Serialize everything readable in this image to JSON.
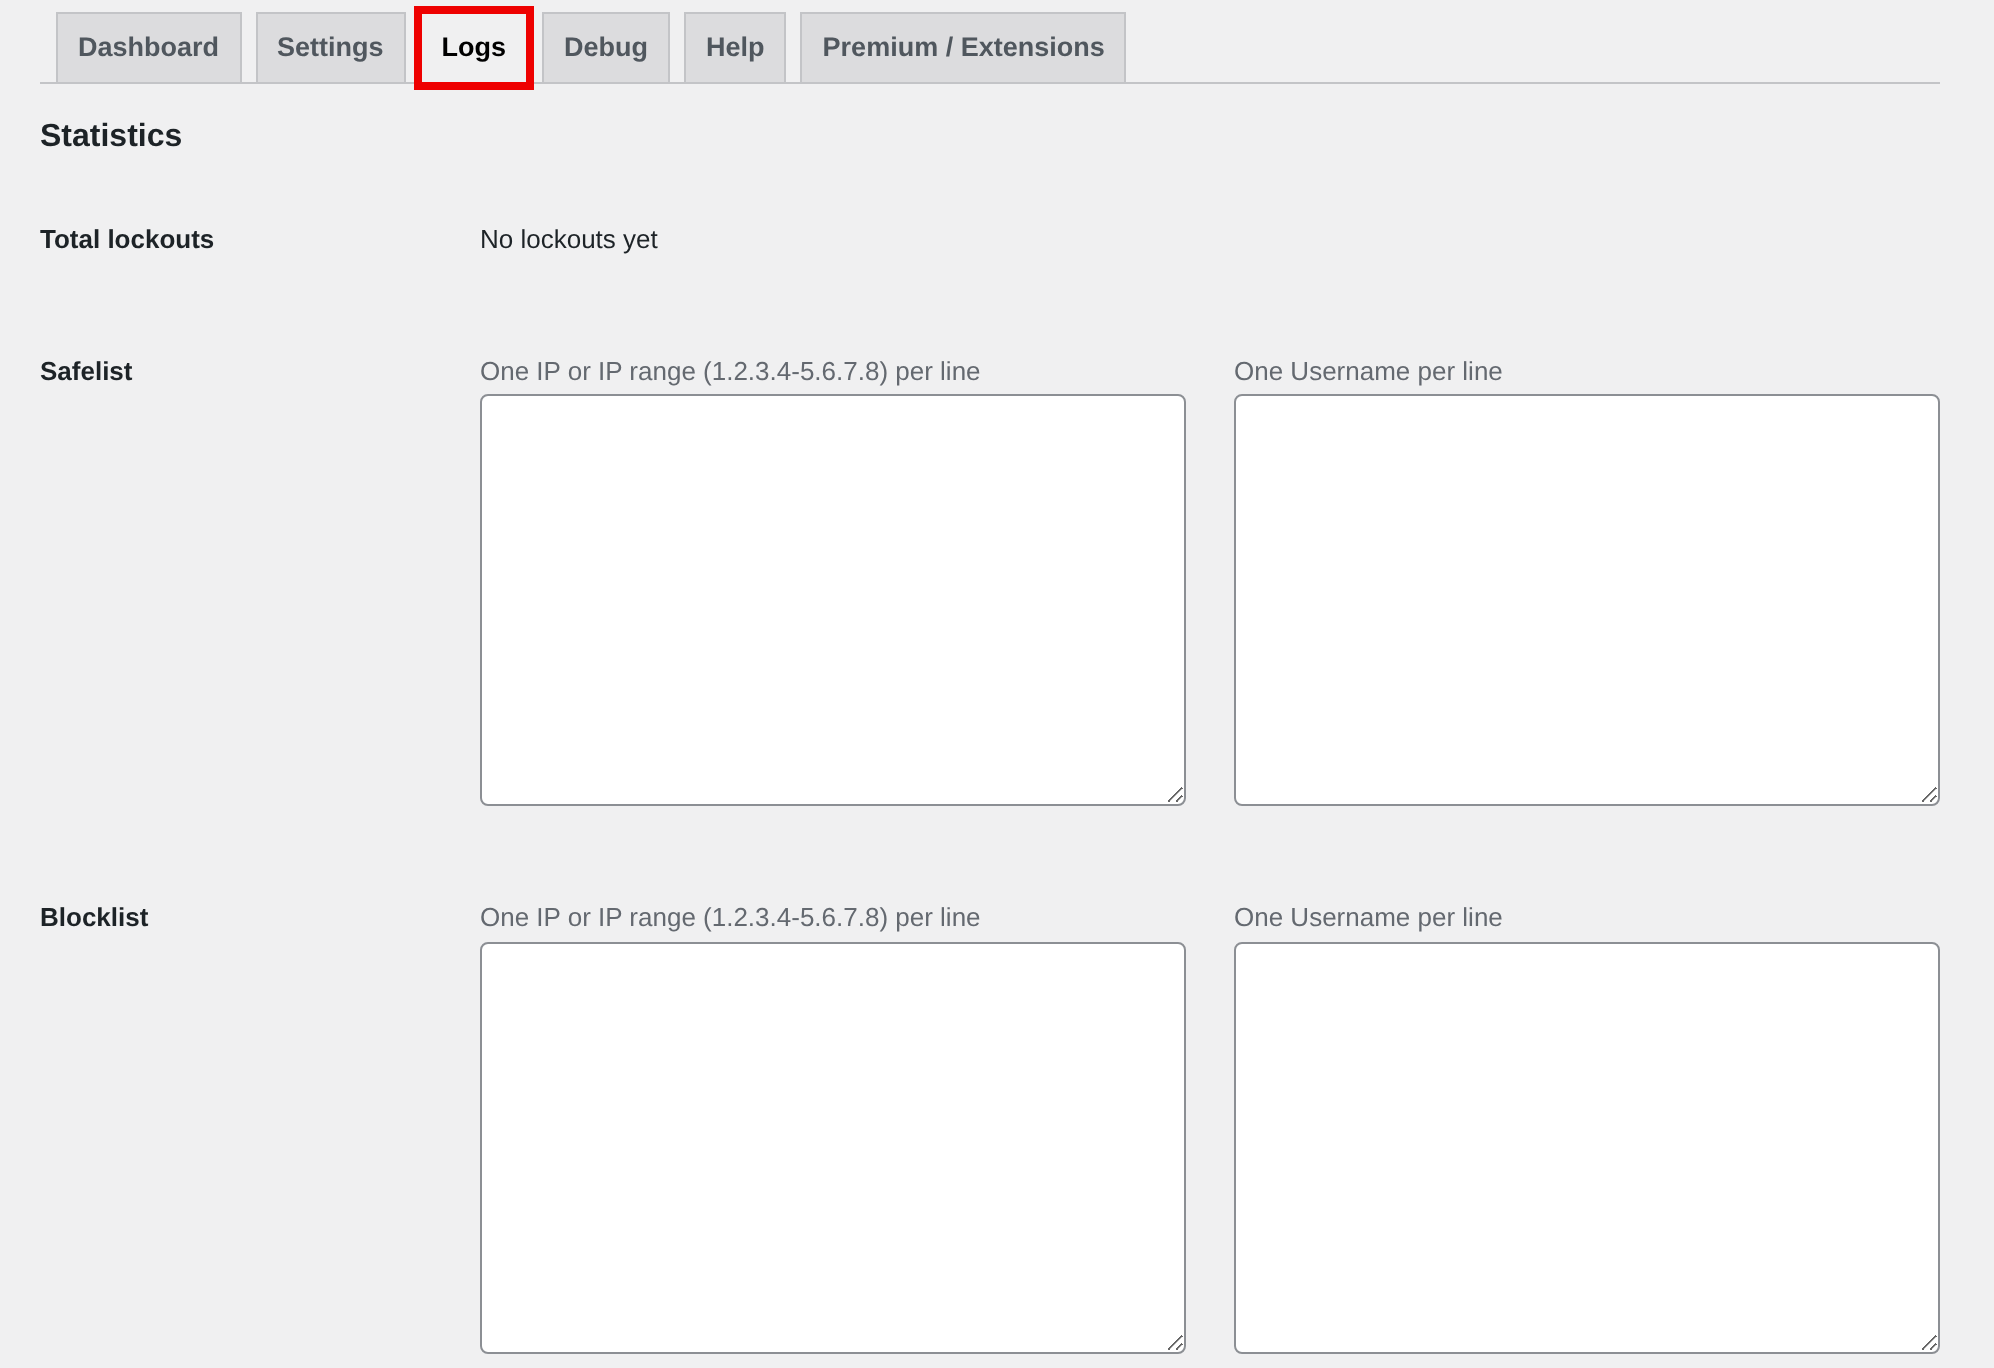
{
  "tabs": [
    {
      "label": "Dashboard",
      "selected": false,
      "highlighted": false
    },
    {
      "label": "Settings",
      "selected": false,
      "highlighted": false
    },
    {
      "label": "Logs",
      "selected": true,
      "highlighted": true
    },
    {
      "label": "Debug",
      "selected": false,
      "highlighted": false
    },
    {
      "label": "Help",
      "selected": false,
      "highlighted": false
    },
    {
      "label": "Premium / Extensions",
      "selected": false,
      "highlighted": false
    }
  ],
  "heading": "Statistics",
  "rows": [
    {
      "kind": "text",
      "label": "Total lockouts",
      "value": "No lockouts yet"
    },
    {
      "kind": "lists",
      "label": "Safelist",
      "fields": [
        {
          "caption": "One IP or IP range (1.2.3.4-5.6.7.8) per line"
        },
        {
          "caption": "One Username per line"
        }
      ]
    },
    {
      "kind": "lists",
      "label": "Blocklist",
      "fields": [
        {
          "caption": "One IP or IP range (1.2.3.4-5.6.7.8) per line"
        },
        {
          "caption": "One Username per line"
        }
      ]
    }
  ]
}
